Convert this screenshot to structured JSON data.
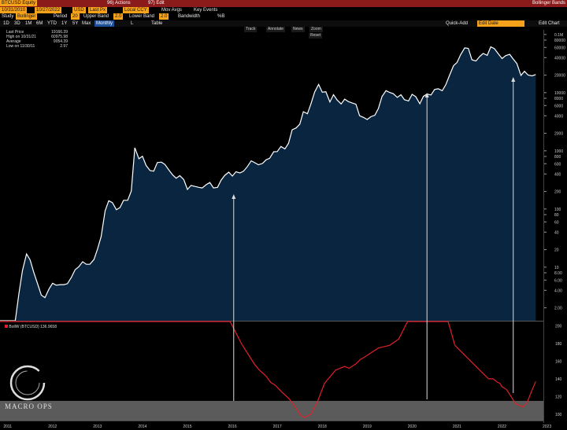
{
  "header": {
    "ticker": "BTCUSD Equity",
    "actions": "96) Actions",
    "edit": "97) Edit",
    "window_title": "Bollinger Bands",
    "date_from": "10/31/2010",
    "date_to": "10/27/2022",
    "mode": "USD",
    "price_type": "Last Px",
    "price_label": "Local CCY",
    "mov_avgs": "Mov Avgs",
    "key_events": "Key Events",
    "study_label": "Study",
    "study_value": "Bollinger",
    "period_label": "Period",
    "period_value": "20",
    "upper_label": "Upper Band",
    "upper_value": "2.0",
    "lower_label": "Lower Band",
    "lower_value": "2.0",
    "bandwidth_label": "Bandwidth",
    "pctb_label": "%B"
  },
  "toolbar": {
    "ranges": [
      "1D",
      "3D",
      "1M",
      "6M",
      "YTD",
      "1Y",
      "5Y",
      "Max"
    ],
    "frequency": "Monthly",
    "extra": [
      "L",
      "Table"
    ],
    "quick_add": "Quick-Add",
    "edit_chart": "Edit Chart",
    "save_label": "Edit Date"
  },
  "subtools": [
    "Track",
    "Annotate",
    "News",
    "Zoom",
    "Reset"
  ],
  "legend": {
    "last_price": "Last Price",
    "last_price_value": "19166.39",
    "high": "High on 10/31/21",
    "high_value": "60975.98",
    "average": "Average",
    "average_value": "9054.39",
    "low": "Low on 11/30/11",
    "low_value": "2.97"
  },
  "lower_legend": {
    "label": "BollW (BTCUSD)",
    "value": "136.9658"
  },
  "watermark": {
    "text": "MACRO OPS"
  },
  "colors": {
    "accent": "#f7a21b",
    "area": "#0a2540",
    "price_line": "#ffffff",
    "bandwidth_line": "#e0202a",
    "highlight_band": "#7a7a7a"
  },
  "chart_data": [
    {
      "type": "area",
      "scale": "log",
      "x_ticks": [
        "2011",
        "2012",
        "2013",
        "2014",
        "2015",
        "2016",
        "2017",
        "2018",
        "2019",
        "2020",
        "2021",
        "2022",
        "2023"
      ],
      "y_ticks": [
        "2.00",
        "4.00",
        "6.00",
        "8.00",
        "10",
        "20",
        "40",
        "60",
        "80",
        "100",
        "200",
        "400",
        "600",
        "800",
        "1000",
        "2000",
        "4000",
        "6000",
        "8000",
        "10000",
        "20000",
        "40000",
        "60000",
        "80000",
        "0.1M"
      ],
      "ylim": [
        1.2,
        120000
      ],
      "x": [
        2010.83,
        2010.92,
        2011.0,
        2011.08,
        2011.17,
        2011.25,
        2011.33,
        2011.42,
        2011.5,
        2011.58,
        2011.67,
        2011.75,
        2011.83,
        2011.92,
        2012.0,
        2012.08,
        2012.17,
        2012.25,
        2012.33,
        2012.42,
        2012.5,
        2012.58,
        2012.67,
        2012.75,
        2012.83,
        2012.92,
        2013.0,
        2013.08,
        2013.17,
        2013.25,
        2013.33,
        2013.42,
        2013.5,
        2013.58,
        2013.67,
        2013.75,
        2013.83,
        2013.92,
        2014.0,
        2014.08,
        2014.17,
        2014.25,
        2014.33,
        2014.42,
        2014.5,
        2014.58,
        2014.67,
        2014.75,
        2014.83,
        2014.92,
        2015.0,
        2015.08,
        2015.17,
        2015.25,
        2015.33,
        2015.42,
        2015.5,
        2015.58,
        2015.67,
        2015.75,
        2015.83,
        2015.92,
        2016.0,
        2016.08,
        2016.17,
        2016.25,
        2016.33,
        2016.42,
        2016.5,
        2016.58,
        2016.67,
        2016.75,
        2016.83,
        2016.92,
        2017.0,
        2017.08,
        2017.17,
        2017.25,
        2017.33,
        2017.42,
        2017.5,
        2017.58,
        2017.67,
        2017.75,
        2017.83,
        2017.92,
        2018.0,
        2018.08,
        2018.17,
        2018.25,
        2018.33,
        2018.42,
        2018.5,
        2018.58,
        2018.67,
        2018.75,
        2018.83,
        2018.92,
        2019.0,
        2019.08,
        2019.17,
        2019.25,
        2019.33,
        2019.42,
        2019.5,
        2019.58,
        2019.67,
        2019.75,
        2019.83,
        2019.92,
        2020.0,
        2020.08,
        2020.17,
        2020.25,
        2020.33,
        2020.42,
        2020.5,
        2020.58,
        2020.67,
        2020.75,
        2020.83,
        2020.92,
        2021.0,
        2021.08,
        2021.17,
        2021.25,
        2021.33,
        2021.42,
        2021.5,
        2021.58,
        2021.67,
        2021.75,
        2021.83,
        2021.92,
        2022.0,
        2022.08,
        2022.17,
        2022.25,
        2022.33,
        2022.42,
        2022.5,
        2022.58,
        2022.67,
        2022.75
      ],
      "values": [
        0.2,
        0.3,
        0.3,
        0.9,
        0.8,
        3.5,
        8.7,
        16.9,
        13.4,
        8.2,
        5.1,
        3.3,
        3.0,
        4.2,
        5.3,
        4.9,
        5.0,
        5.0,
        5.2,
        6.7,
        9.0,
        10.1,
        12.4,
        11.2,
        11.2,
        13.5,
        20.4,
        33.4,
        93,
        139,
        129,
        97,
        106,
        141,
        141,
        203,
        1130,
        732,
        806,
        562,
        457,
        447,
        629,
        640,
        582,
        478,
        386,
        338,
        375,
        320,
        217,
        254,
        244,
        236,
        230,
        263,
        285,
        230,
        236,
        314,
        378,
        430,
        368,
        437,
        416,
        448,
        531,
        673,
        624,
        575,
        608,
        700,
        745,
        964,
        970,
        1190,
        1080,
        1350,
        2300,
        2480,
        2880,
        4700,
        4340,
        6470,
        10200,
        13860,
        10221,
        10333,
        6928,
        9240,
        7494,
        6404,
        7729,
        7037,
        6625,
        6318,
        4017,
        3742,
        3457,
        3854,
        4105,
        5350,
        8574,
        10817,
        10085,
        9597,
        8293,
        9199,
        7569,
        7193,
        9350,
        8543,
        6439,
        8629,
        9454,
        9137,
        11351,
        11655,
        10784,
        13804,
        19700,
        29001,
        33114,
        45137,
        58918,
        57750,
        36684,
        35040,
        41626,
        47166,
        43790,
        61318,
        57005,
        46306,
        38483,
        43193,
        45538,
        37714,
        31792,
        19784,
        23293,
        20050,
        19431,
        20495
      ]
    },
    {
      "type": "line",
      "name": "BollW (BTCUSD)",
      "y_ticks": [
        "100",
        "120",
        "140",
        "160",
        "180",
        "200"
      ],
      "ylim": [
        90,
        205
      ],
      "x": [
        2010.83,
        2011.0,
        2011.2,
        2011.45,
        2011.55,
        2011.7,
        2011.85,
        2012.0,
        2012.2,
        2012.45,
        2012.7,
        2012.95,
        2013.2,
        2013.45,
        2013.7,
        2013.95,
        2014.2,
        2014.4,
        2014.6,
        2014.8,
        2014.95,
        2015.05,
        2015.2,
        2015.35,
        2015.5,
        2015.6,
        2015.75,
        2015.85,
        2015.95,
        2016.05,
        2016.1,
        2016.2,
        2016.35,
        2016.5,
        2016.6,
        2016.75,
        2016.85,
        2016.95,
        2017.1,
        2017.25,
        2017.35,
        2017.5,
        2017.6,
        2017.75,
        2017.9,
        2018.05,
        2018.3,
        2018.5,
        2018.6,
        2018.75,
        2018.85,
        2018.95,
        2019.1,
        2019.25,
        2019.5,
        2019.7,
        2019.9,
        2020.05,
        2020.2,
        2020.35,
        2020.45,
        2020.55,
        2020.6,
        2020.7,
        2020.8,
        2020.85,
        2020.95,
        2021.5,
        2021.7,
        2021.8,
        2021.9,
        2021.95,
        2022.0,
        2022.1,
        2022.2,
        2022.3,
        2022.45,
        2022.55,
        2022.65,
        2022.75
      ],
      "values": [
        205,
        205,
        205,
        205,
        205,
        205,
        205,
        205,
        205,
        205,
        205,
        205,
        205,
        205,
        205,
        205,
        205,
        205,
        205,
        205,
        205,
        205,
        205,
        205,
        205,
        205,
        205,
        205,
        205,
        195,
        190,
        180,
        168,
        156,
        150,
        143,
        136,
        133,
        125,
        118,
        112,
        100,
        96,
        100,
        115,
        135,
        150,
        154,
        152,
        157,
        162,
        165,
        170,
        175,
        178,
        185,
        205,
        205,
        205,
        205,
        205,
        205,
        205,
        205,
        205,
        196,
        178,
        150,
        140,
        140,
        136,
        135,
        131,
        128,
        120,
        112,
        108,
        112,
        125,
        137
      ]
    }
  ]
}
